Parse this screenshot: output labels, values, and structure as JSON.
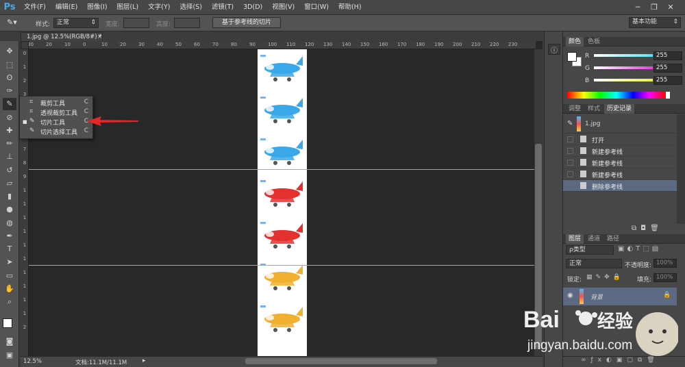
{
  "app": {
    "logo": "Ps",
    "menus": [
      "文件(F)",
      "编辑(E)",
      "图像(I)",
      "图层(L)",
      "文字(Y)",
      "选择(S)",
      "滤镜(T)",
      "3D(D)",
      "视图(V)",
      "窗口(W)",
      "帮助(H)"
    ]
  },
  "options": {
    "style_label": "样式:",
    "style_value": "正常",
    "width_label": "宽度:",
    "height_label": "高度:",
    "slices_button": "基于参考线的切片",
    "workspace": "基本功能"
  },
  "document": {
    "tab_title": "1.jpg @ 12.5%(RGB/8#) *",
    "zoom": "12.5%",
    "doc_size": "文档:11.1M/11.1M"
  },
  "ruler": {
    "top": [
      "30",
      "20",
      "10",
      "0",
      "10",
      "20",
      "30",
      "40",
      "50",
      "60",
      "70",
      "80",
      "90",
      "100",
      "110",
      "120",
      "130",
      "140",
      "150",
      "160",
      "170",
      "180",
      "190",
      "200",
      "210",
      "220",
      "230"
    ],
    "left": [
      "0",
      "1",
      "2",
      "3",
      "4",
      "5",
      "6",
      "7",
      "8",
      "9",
      "1",
      "1",
      "1",
      "1",
      "1",
      "1",
      "1",
      "1",
      "1",
      "1",
      "2"
    ]
  },
  "flyout": [
    {
      "label": "裁剪工具",
      "key": "C"
    },
    {
      "label": "透视裁剪工具",
      "key": "C"
    },
    {
      "label": "切片工具",
      "key": "C"
    },
    {
      "label": "切片选择工具",
      "key": "C"
    }
  ],
  "color_panel": {
    "tabs": [
      "颜色",
      "色板"
    ],
    "r_label": "R",
    "g_label": "G",
    "b_label": "B",
    "r": "255",
    "g": "255",
    "b": "255",
    "colors": {
      "r": "#5fe0f0",
      "g": "#e040e0",
      "b": "#f0f040"
    }
  },
  "history_panel": {
    "tabs": [
      "调整",
      "样式",
      "历史记录"
    ],
    "snapshot": "1.jpg",
    "states": [
      "打开",
      "新建参考线",
      "新建参考线",
      "新建参考线",
      "删除参考线"
    ]
  },
  "layers_panel": {
    "tabs": [
      "图层",
      "通道",
      "路径"
    ],
    "filter": "ρ类型",
    "blend_mode": "正常",
    "opacity_label": "不透明度:",
    "opacity_value": "100%",
    "lock_label": "锁定:",
    "fill_label": "填充:",
    "fill_value": "100%",
    "layer_name": "背景"
  },
  "watermark": {
    "brand": "Bai",
    "brand2": "经验",
    "url": "jingyan.baidu.com"
  },
  "plane_colors": [
    "#3aa8e8",
    "#3aa8e8",
    "#3aa8e8",
    "#e53030",
    "#e53030",
    "#f0b030",
    "#f0b030"
  ]
}
